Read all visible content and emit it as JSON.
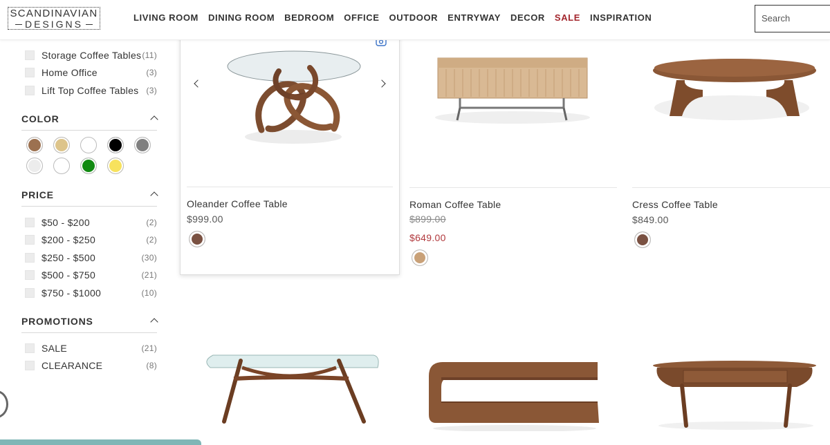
{
  "brand": {
    "line1": "SCANDINAVIAN",
    "line2": "DESIGNS"
  },
  "nav": {
    "items": [
      "LIVING ROOM",
      "DINING ROOM",
      "BEDROOM",
      "OFFICE",
      "OUTDOOR",
      "ENTRYWAY",
      "DECOR",
      "SALE",
      "INSPIRATION"
    ]
  },
  "search": {
    "placeholder": "Search"
  },
  "filters": {
    "category_items": [
      {
        "label": "Storage Coffee Tables",
        "count": "(11)"
      },
      {
        "label": "Home Office",
        "count": "(3)"
      },
      {
        "label": "Lift Top Coffee Tables",
        "count": "(3)"
      }
    ],
    "color": {
      "title": "COLOR",
      "swatches": [
        "#9c7150",
        "#ddc48a",
        "#ffffff",
        "#000000",
        "#808080",
        "#ececec",
        "#ffffff",
        "#118a11",
        "#f7e25d"
      ]
    },
    "price": {
      "title": "PRICE",
      "items": [
        {
          "label": "$50 - $200",
          "count": "(2)"
        },
        {
          "label": "$200 - $250",
          "count": "(2)"
        },
        {
          "label": "$250 - $500",
          "count": "(30)"
        },
        {
          "label": "$500 - $750",
          "count": "(21)"
        },
        {
          "label": "$750 - $1000",
          "count": "(10)"
        }
      ]
    },
    "promotions": {
      "title": "PROMOTIONS",
      "items": [
        {
          "label": "SALE",
          "count": "(21)"
        },
        {
          "label": "CLEARANCE",
          "count": "(8)"
        }
      ]
    }
  },
  "products": [
    {
      "name": "Oleander Coffee Table",
      "price": "$999.00",
      "swatch": "#7a5142"
    },
    {
      "name": "Roman Coffee Table",
      "old_price": "$899.00",
      "price": "$649.00",
      "swatch": "#c9a178"
    },
    {
      "name": "Cress Coffee Table",
      "price": "$849.00",
      "swatch": "#7a5142"
    }
  ]
}
